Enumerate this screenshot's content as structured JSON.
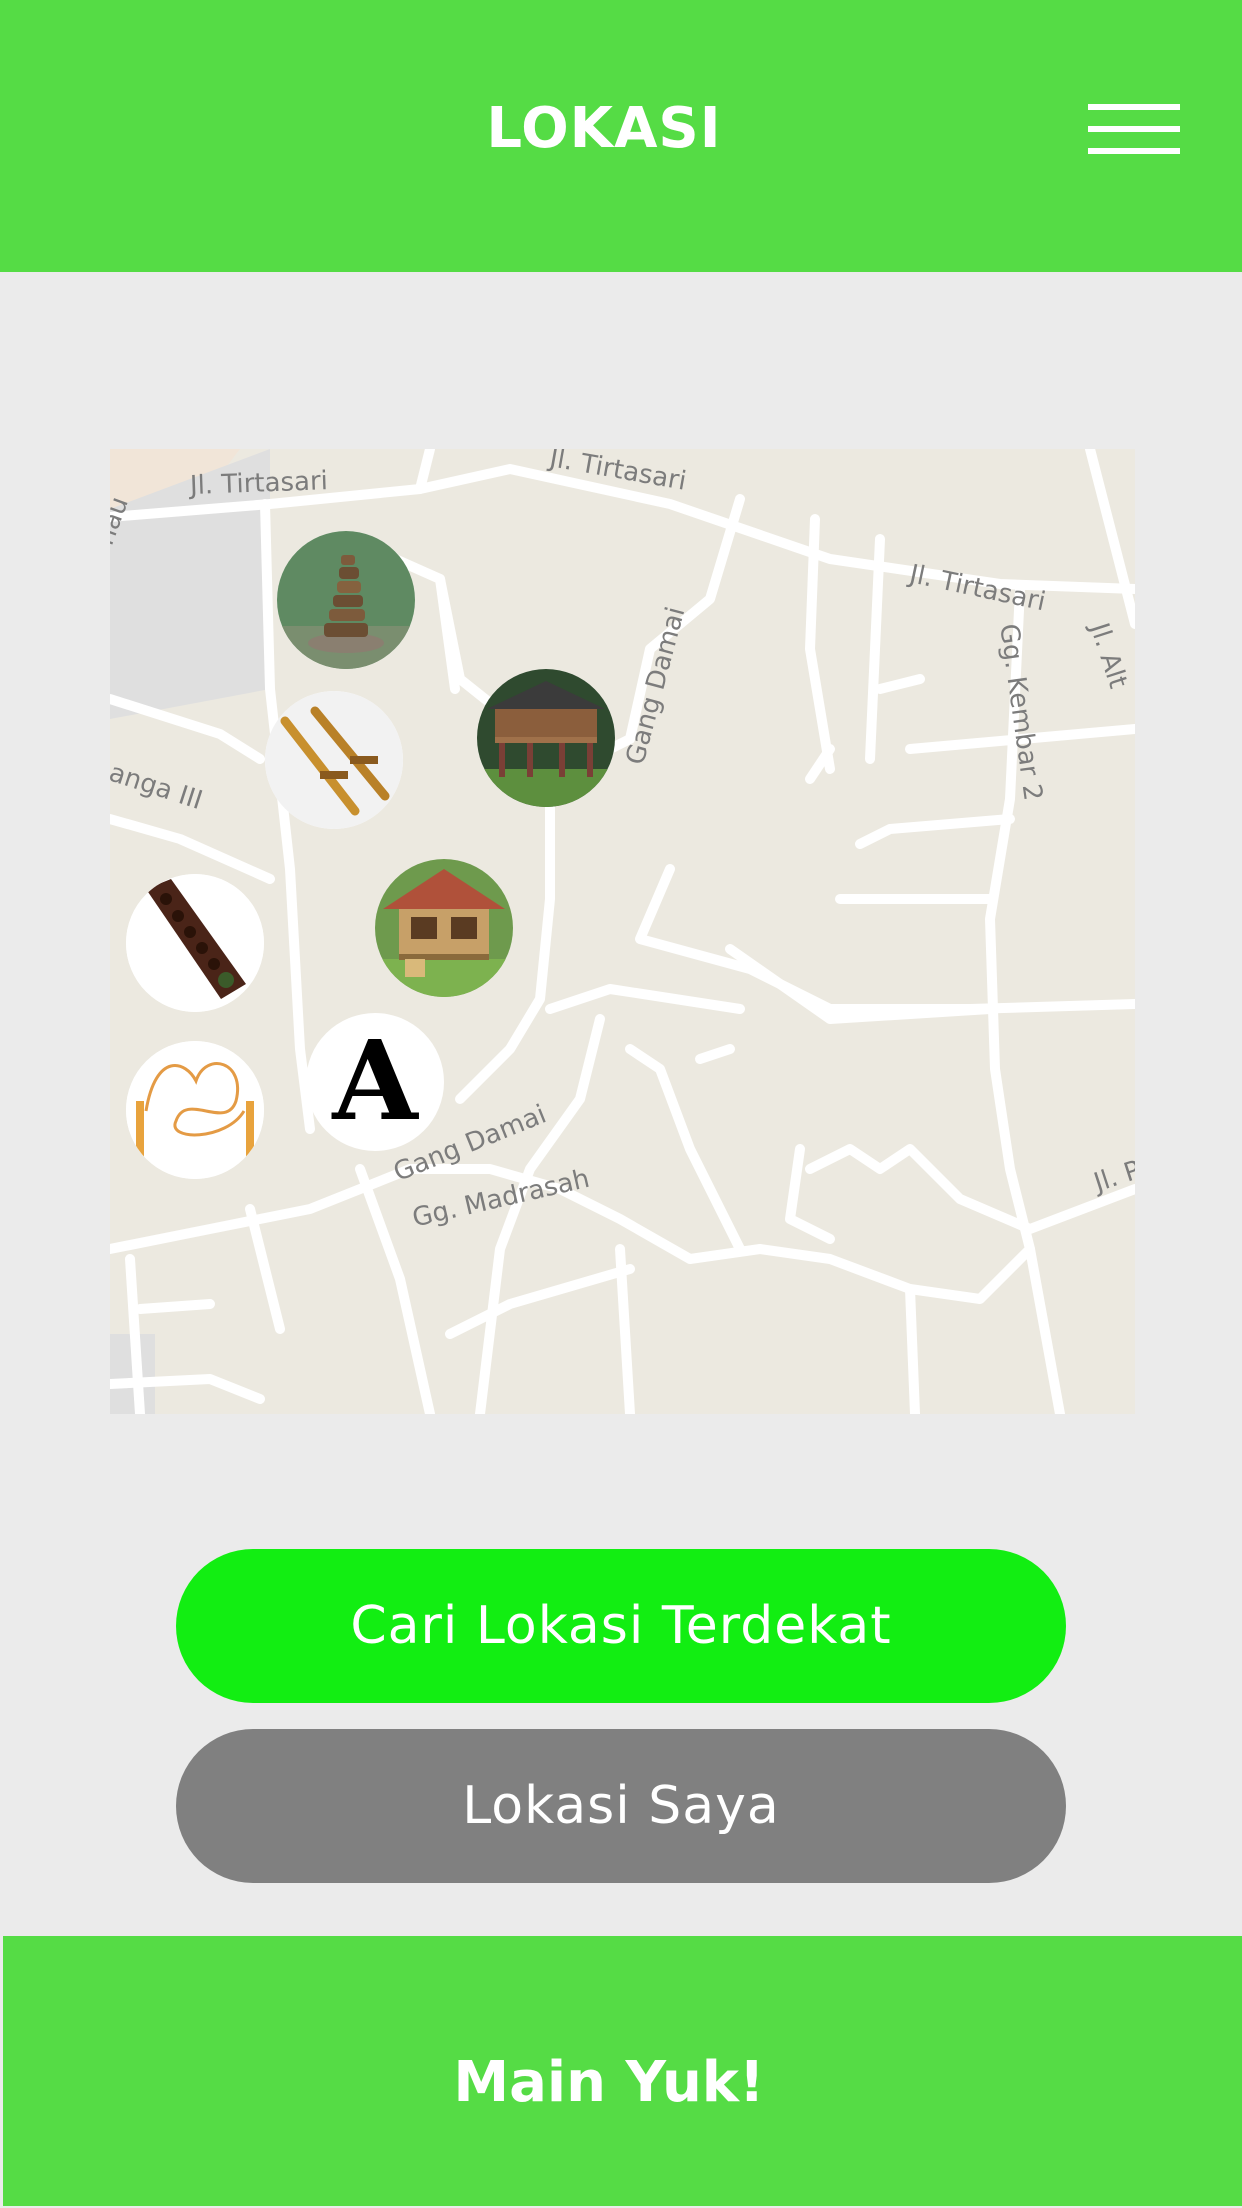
{
  "header": {
    "title": "LOKASI",
    "menu_icon": "hamburger-icon"
  },
  "map": {
    "streets": {
      "tirtasari_1": "Jl. Tirtasari",
      "tirtasari_2": "Jl. Tirtasari",
      "tirtasari_3": "Jl. Tirtasari",
      "gang_damai_1": "Gang Damai",
      "gang_damai_2": "Gang Damai",
      "kembar": "Gg. Kembar 2",
      "madrasah": "Gg. Madrasah",
      "ganga": "anga III",
      "alt": "Jl. Alt",
      "jl_right": "Jl. P",
      "nau": "nau"
    },
    "markers": [
      {
        "icon": "stone-stack-icon"
      },
      {
        "icon": "stilt-house-icon"
      },
      {
        "icon": "bamboo-stilts-icon"
      },
      {
        "icon": "bamboo-hut-icon"
      },
      {
        "icon": "congklak-board-icon"
      },
      {
        "icon": "rope-game-icon"
      },
      {
        "icon": "letter-a-icon",
        "letter": "A"
      }
    ]
  },
  "buttons": {
    "nearest": "Cari Lokasi Terdekat",
    "mine": "Lokasi Saya"
  },
  "footer": {
    "label": "Main Yuk!"
  },
  "colors": {
    "header_green": "#55dc45",
    "button_green": "#12ee12",
    "button_gray": "#808080",
    "background": "#ebebeb"
  }
}
